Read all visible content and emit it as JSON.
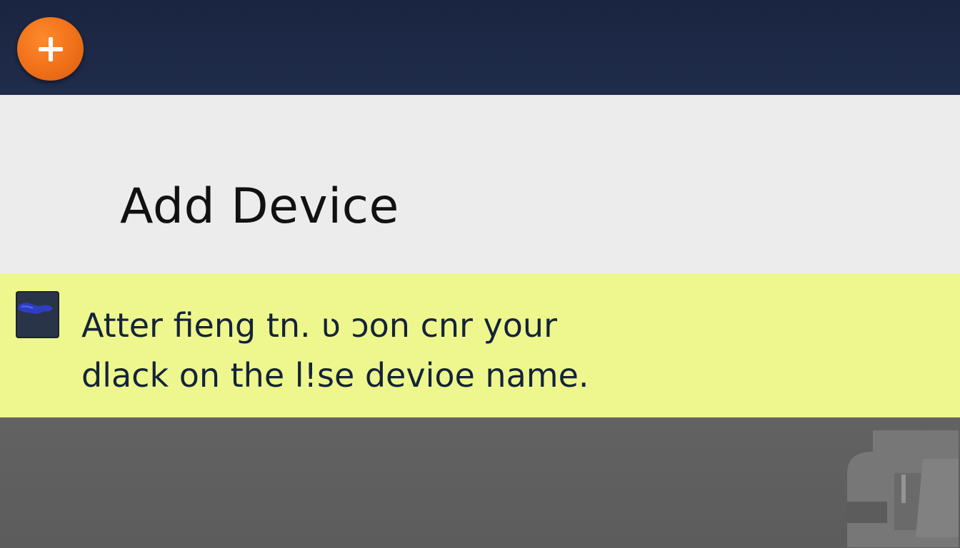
{
  "header": {
    "add_button_icon": "plus-icon",
    "accent_color": "#f0701a",
    "background_color": "#1f2c4a"
  },
  "main": {
    "title": "Add Device"
  },
  "tip": {
    "icon": "device-thumbnail-icon",
    "line1": "Atter fieng tn. ʋ ɔon cnr your",
    "line2": "dlack on the l!se devioe  name.",
    "background_color": "#eef78d"
  },
  "footer": {
    "icon": "device-silhouette-icon",
    "background_color": "#5e5e5e"
  }
}
